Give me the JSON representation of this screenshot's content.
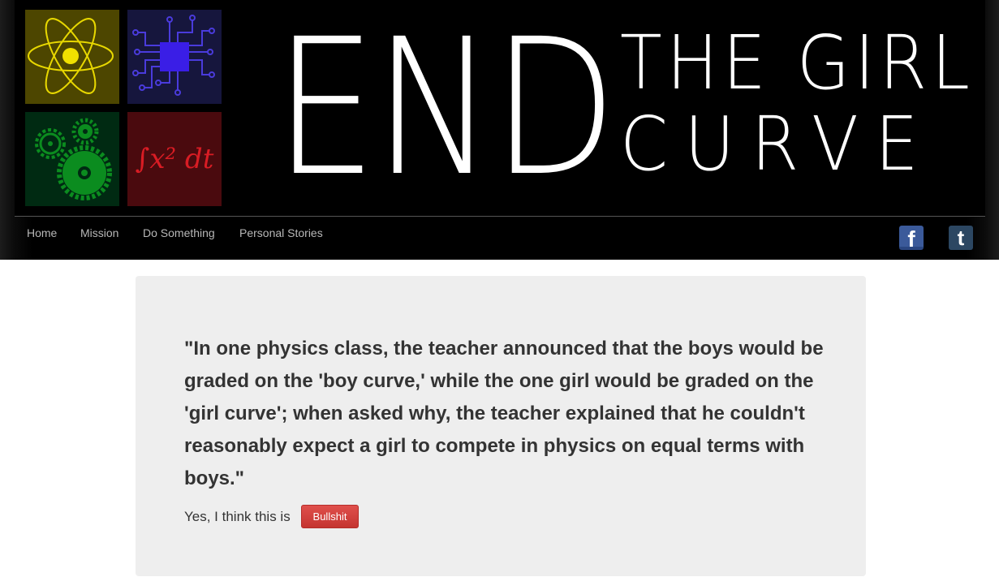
{
  "header": {
    "tiles": {
      "atom_icon": "atom-icon",
      "chip_icon": "circuit-chip-icon",
      "gears_icon": "gears-icon",
      "math_text": "∫x² dt"
    },
    "title": {
      "big": "END",
      "line1": "THE GIRL",
      "line2": "CURVE"
    }
  },
  "nav": {
    "items": [
      {
        "label": "Home"
      },
      {
        "label": "Mission"
      },
      {
        "label": "Do Something"
      },
      {
        "label": "Personal Stories"
      }
    ],
    "social": {
      "facebook": "f",
      "tumblr": "t"
    }
  },
  "story": {
    "quote": "\"In one physics class, the teacher announced that the boys would be graded on the 'boy curve,' while the one girl would be graded on the 'girl curve'; when asked why, the teacher explained that he couldn't reasonably expect a girl to compete in physics on equal terms with boys.\"",
    "verdict_label": "Yes, I think this is",
    "verdict_button": "Bullshit"
  },
  "colors": {
    "tile_atom": "#4d4600",
    "tile_chip": "#16163d",
    "tile_gears": "#002a12",
    "tile_math": "#4a0a0e",
    "button_red": "#d9534f",
    "facebook_blue": "#3b5a9a",
    "tumblr_blue": "#2c4762"
  }
}
